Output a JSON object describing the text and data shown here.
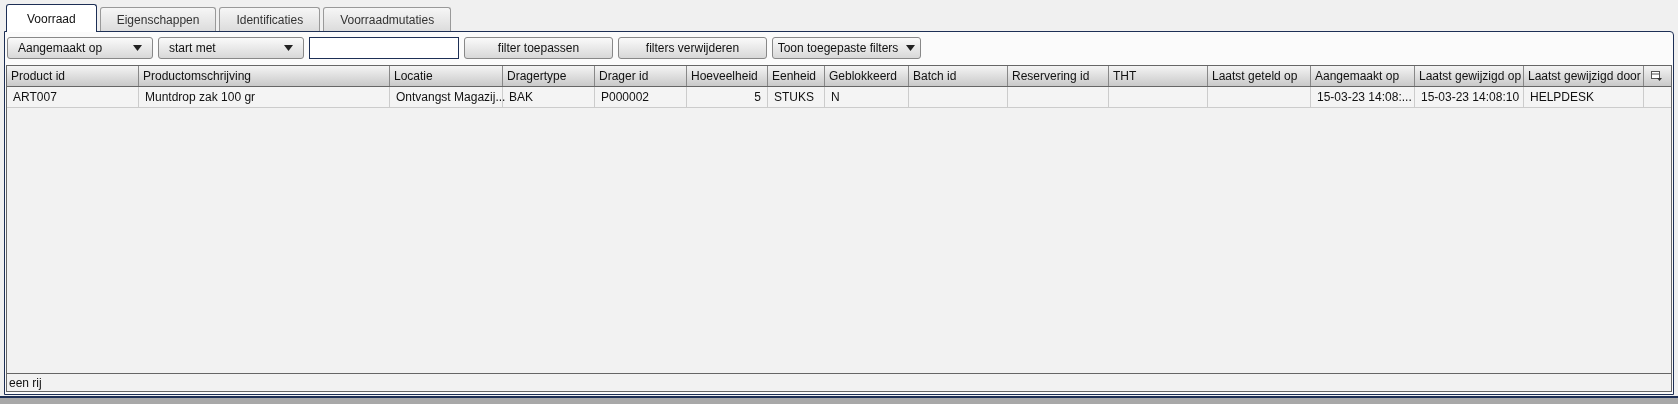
{
  "tabs": [
    {
      "label": "Voorraad",
      "selected": true
    },
    {
      "label": "Eigenschappen",
      "selected": false
    },
    {
      "label": "Identificaties",
      "selected": false
    },
    {
      "label": "Voorraadmutaties",
      "selected": false
    }
  ],
  "toolbar": {
    "field_dropdown": "Aangemaakt op",
    "operator_dropdown": "start met",
    "buttons": [
      "filter toepassen",
      "filters verwijderen"
    ],
    "menu_button": "Toon toegepaste filters"
  },
  "table": {
    "columns": [
      {
        "label": "Product id",
        "kind": "text"
      },
      {
        "label": "Productomschrijving",
        "kind": "text"
      },
      {
        "label": "Locatie",
        "kind": "text"
      },
      {
        "label": "Dragertype",
        "kind": "text"
      },
      {
        "label": "Drager id",
        "kind": "text"
      },
      {
        "label": "Hoeveelheid",
        "kind": "number"
      },
      {
        "label": "Eenheid",
        "kind": "text"
      },
      {
        "label": "Geblokkeerd",
        "kind": "text"
      },
      {
        "label": "Batch id",
        "kind": "text"
      },
      {
        "label": "Reservering id",
        "kind": "text"
      },
      {
        "label": "THT",
        "kind": "text"
      },
      {
        "label": "Laatst geteld op",
        "kind": "text"
      },
      {
        "label": "Aangemaakt op",
        "kind": "text"
      },
      {
        "label": "Laatst gewijzigd op",
        "kind": "text"
      },
      {
        "label": "Laatst gewijzigd door",
        "kind": "text"
      }
    ],
    "rows": [
      [
        "ART007",
        "Muntdrop zak 100 gr",
        "Ontvangst Magazij...",
        "BAK",
        "P000002",
        "5",
        "STUKS",
        "N",
        "",
        "",
        "",
        "",
        "15-03-23 14:08:...",
        "15-03-23 14:08:10",
        "HELPDESK"
      ]
    ]
  },
  "status_bar": "een rij"
}
